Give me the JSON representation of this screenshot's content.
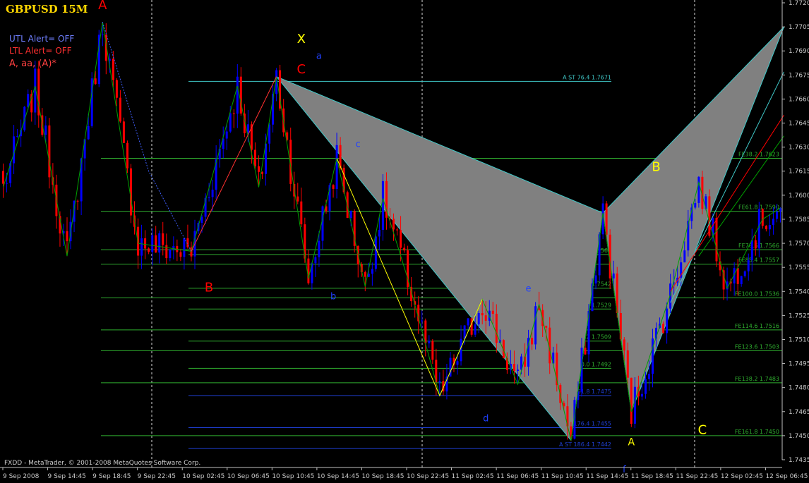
{
  "window": {
    "title": "GBPUSD 15M",
    "footer": "FXDD - MetaTrader, © 2001-2008 MetaQuotes Software Corp."
  },
  "alerts": {
    "utl": "UTL Alert= OFF",
    "ltl": "LTL Alert= OFF",
    "mode": "A, aa, (A)*"
  },
  "colors": {
    "background": "#000000",
    "bull": "#0000ff",
    "bear": "#ff0000",
    "level_green": "#2fae2f",
    "level_cyan": "#3fc8c8",
    "level_blue": "#1f3fd6",
    "pattern_fill": "#808080",
    "zigzag_green": "#00a000",
    "zigzag_yellow": "#ffff00",
    "axis_text": "#c8c8c8"
  },
  "chart_data": {
    "type": "candlestick",
    "symbol": "GBPUSD",
    "timeframe": "15M",
    "ylim": [
      1.7435,
      1.772
    ],
    "y_ticks": [
      "1.7720",
      "1.7705",
      "1.7690",
      "1.7675",
      "1.7660",
      "1.7645",
      "1.7630",
      "1.7615",
      "1.7600",
      "1.7585",
      "1.7570",
      "1.7555",
      "1.7540",
      "1.7525",
      "1.7510",
      "1.7495",
      "1.7480",
      "1.7465",
      "1.7450",
      "1.7435"
    ],
    "x_ticks": [
      "9 Sep 2008",
      "9 Sep 14:45",
      "9 Sep 18:45",
      "9 Sep 22:45",
      "10 Sep 02:45",
      "10 Sep 06:45",
      "10 Sep 10:45",
      "10 Sep 14:45",
      "10 Sep 18:45",
      "10 Sep 22:45",
      "11 Sep 02:45",
      "11 Sep 06:45",
      "11 Sep 10:45",
      "11 Sep 14:45",
      "11 Sep 18:45",
      "11 Sep 22:45",
      "12 Sep 02:45",
      "12 Sep 06:45"
    ],
    "bar_count": 220,
    "swings": [
      {
        "bar": 0,
        "price": 1.7605
      },
      {
        "bar": 9,
        "price": 1.7668
      },
      {
        "bar": 18,
        "price": 1.7562
      },
      {
        "bar": 28,
        "price": 1.7708
      },
      {
        "bar": 38,
        "price": 1.757
      },
      {
        "bar": 53,
        "price": 1.7565
      },
      {
        "bar": 66,
        "price": 1.7668
      },
      {
        "bar": 72,
        "price": 1.7605
      },
      {
        "bar": 77,
        "price": 1.7674
      },
      {
        "bar": 86,
        "price": 1.7548
      },
      {
        "bar": 94,
        "price": 1.7623
      },
      {
        "bar": 102,
        "price": 1.7543
      },
      {
        "bar": 107,
        "price": 1.7598
      },
      {
        "bar": 114,
        "price": 1.7548
      },
      {
        "bar": 123,
        "price": 1.7475
      },
      {
        "bar": 135,
        "price": 1.7535
      },
      {
        "bar": 145,
        "price": 1.7482
      },
      {
        "bar": 151,
        "price": 1.7532
      },
      {
        "bar": 160,
        "price": 1.7447
      },
      {
        "bar": 169,
        "price": 1.7589
      },
      {
        "bar": 177,
        "price": 1.7465
      },
      {
        "bar": 188,
        "price": 1.7538
      },
      {
        "bar": 196,
        "price": 1.7608
      },
      {
        "bar": 204,
        "price": 1.7542
      },
      {
        "bar": 214,
        "price": 1.7585
      },
      {
        "bar": 219,
        "price": 1.7592
      }
    ],
    "zigzag_green": [
      [
        0,
        1.7605
      ],
      [
        9,
        1.7668
      ],
      [
        18,
        1.7562
      ],
      [
        28,
        1.7708
      ],
      [
        38,
        1.757
      ],
      [
        53,
        1.7565
      ],
      [
        66,
        1.7668
      ],
      [
        72,
        1.7605
      ],
      [
        77,
        1.7674
      ],
      [
        86,
        1.7548
      ],
      [
        94,
        1.7623
      ],
      [
        102,
        1.7543
      ],
      [
        107,
        1.7598
      ],
      [
        114,
        1.7548
      ],
      [
        123,
        1.7475
      ],
      [
        135,
        1.7535
      ],
      [
        145,
        1.7482
      ],
      [
        151,
        1.7532
      ],
      [
        160,
        1.7447
      ],
      [
        169,
        1.7589
      ],
      [
        177,
        1.7465
      ],
      [
        188,
        1.7538
      ],
      [
        196,
        1.7608
      ],
      [
        204,
        1.7542
      ],
      [
        214,
        1.7585
      ],
      [
        219,
        1.7592
      ]
    ],
    "zigzag_yellow": [
      [
        94,
        1.7623
      ],
      [
        123,
        1.7475
      ],
      [
        135,
        1.7535
      ]
    ],
    "zigzag_blue": [
      [
        28,
        1.7708
      ],
      [
        41,
        1.7615
      ],
      [
        53,
        1.7565
      ]
    ],
    "zigzag_red": [
      [
        53,
        1.7565
      ],
      [
        77,
        1.7674
      ]
    ],
    "pattern": {
      "triangle1": [
        [
          77,
          1.7674
        ],
        [
          169,
          1.7589
        ],
        [
          160,
          1.7447
        ]
      ],
      "triangle2": [
        [
          169,
          1.7589
        ],
        [
          177,
          1.7465
        ],
        [
          220,
          1.7705
        ]
      ]
    },
    "projection_lines": [
      {
        "color": "#3fc8c8",
        "points": [
          [
            188,
            1.7533
          ],
          [
            220,
            1.7677
          ]
        ]
      },
      {
        "color": "#ff0000",
        "points": [
          [
            188,
            1.754
          ],
          [
            220,
            1.765
          ]
        ]
      },
      {
        "color": "#00a000",
        "points": [
          [
            196,
            1.7562
          ],
          [
            220,
            1.7637
          ]
        ]
      }
    ],
    "levels_full": [
      {
        "price": 1.7623,
        "label": "FE38.2  1.7623"
      },
      {
        "price": 1.759,
        "label": "FE61.8  1.7590"
      },
      {
        "price": 1.7566,
        "label": "FE78.6  1.7566"
      },
      {
        "price": 1.7557,
        "label": "FE85.4  1.7557"
      },
      {
        "price": 1.7536,
        "label": "FE100.0  1.7536"
      },
      {
        "price": 1.7516,
        "label": "FE114.6  1.7516"
      },
      {
        "price": 1.7503,
        "label": "FE123.6  1.7503"
      },
      {
        "price": 1.7483,
        "label": "FE138.2  1.7483"
      },
      {
        "price": 1.745,
        "label": "FE161.8  1.7450"
      }
    ],
    "levels_st": [
      {
        "price": 1.7671,
        "label": "A ST 76.4  1.7671",
        "color": "#3fc8c8"
      },
      {
        "price": 1.7563,
        "label": "A ST 100.0  1.7563",
        "color": "#2fae2f"
      },
      {
        "price": 1.7542,
        "label": "A ST 114.6  1.7542",
        "color": "#2fae2f"
      },
      {
        "price": 1.7529,
        "label": "A ST 123.6  1.7529",
        "color": "#2fae2f"
      },
      {
        "price": 1.7509,
        "label": "A ST 138.2  1.7509",
        "color": "#2fae2f"
      },
      {
        "price": 1.7492,
        "label": "A ST 150.0  1.7492",
        "color": "#2fae2f"
      },
      {
        "price": 1.7475,
        "label": "161.8  1.7475",
        "color": "#1f3fd6"
      },
      {
        "price": 1.7455,
        "label": "176.4  1.7455",
        "color": "#1f3fd6"
      },
      {
        "price": 1.7442,
        "label": "A ST 186.4  1.7442",
        "color": "#1f3fd6"
      }
    ],
    "labels": [
      {
        "text": "A",
        "bar": 28,
        "price": 1.7716,
        "color": "#ff0000",
        "size": 18
      },
      {
        "text": "B",
        "bar": 58,
        "price": 1.754,
        "color": "#ff0000",
        "size": 18
      },
      {
        "text": "X",
        "bar": 84,
        "price": 1.7695,
        "color": "#ffff00",
        "size": 18
      },
      {
        "text": "C",
        "bar": 84,
        "price": 1.7676,
        "color": "#ff0000",
        "size": 18
      },
      {
        "text": "a",
        "bar": 89,
        "price": 1.7685,
        "color": "#2040ff",
        "size": 13
      },
      {
        "text": "b",
        "bar": 93,
        "price": 1.7535,
        "color": "#2040ff",
        "size": 13
      },
      {
        "text": "c",
        "bar": 100,
        "price": 1.763,
        "color": "#2040ff",
        "size": 13
      },
      {
        "text": "d",
        "bar": 136,
        "price": 1.7459,
        "color": "#2040ff",
        "size": 13
      },
      {
        "text": "e",
        "bar": 148,
        "price": 1.754,
        "color": "#2040ff",
        "size": 13
      },
      {
        "text": "A",
        "bar": 177,
        "price": 1.7444,
        "color": "#ffff00",
        "size": 14
      },
      {
        "text": "f",
        "bar": 175,
        "price": 1.7427,
        "color": "#2040ff",
        "size": 13
      },
      {
        "text": "B",
        "bar": 184,
        "price": 1.7615,
        "color": "#ffff00",
        "size": 18
      },
      {
        "text": "C",
        "bar": 197,
        "price": 1.7451,
        "color": "#ffff00",
        "size": 18
      }
    ]
  }
}
